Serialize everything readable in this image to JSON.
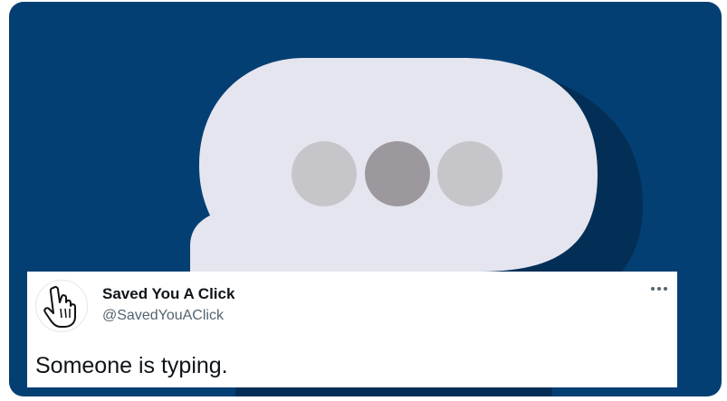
{
  "media": {
    "background_color": "#043f73",
    "bubble_color": "#e4e5ee",
    "shadow_color": "#032f57",
    "dots": [
      {
        "color": "#c6c6ca"
      },
      {
        "color": "#9c989e"
      },
      {
        "color": "#c6c6ca"
      }
    ]
  },
  "tweet": {
    "display_name": "Saved You A Click",
    "handle": "@SavedYouAClick",
    "text": "Someone is typing.",
    "avatar_icon": "pointing-hand-cursor-icon",
    "more_icon": "more-options-icon"
  }
}
